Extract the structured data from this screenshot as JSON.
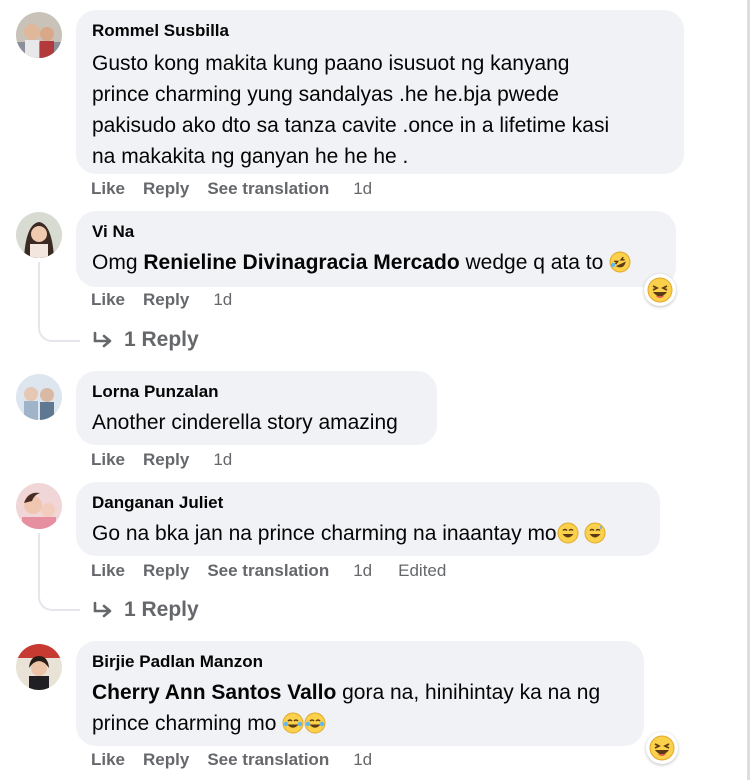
{
  "comments": [
    {
      "author": "Rommel Susbilla",
      "lines": [
        "Gusto kong makita kung paano isusuot ng kanyang",
        "prince charming yung sandalyas .he he.bja pwede",
        "pakisudo ako dto sa tanza cavite .once in a lifetime kasi",
        "na makakita ng ganyan he he he ."
      ],
      "actions": {
        "like": "Like",
        "reply": "Reply",
        "translate": "See translation",
        "time": "1d"
      }
    },
    {
      "author": "Vi Na",
      "prefix": "Omg",
      "mention": "Renieline Divinagracia Mercado",
      "suffix": "wedge q ata to",
      "actions": {
        "like": "Like",
        "reply": "Reply",
        "time": "1d"
      },
      "replies_label": "1 Reply",
      "reaction_icon": "laughing-emoji"
    },
    {
      "author": "Lorna Punzalan",
      "text": "Another cinderella story amazing",
      "actions": {
        "like": "Like",
        "reply": "Reply",
        "time": "1d"
      }
    },
    {
      "author": "Danganan Juliet",
      "text": "Go na bka jan na prince charming na inaantay mo",
      "actions": {
        "like": "Like",
        "reply": "Reply",
        "translate": "See translation",
        "time": "1d",
        "edited": "Edited"
      },
      "replies_label": "1 Reply"
    },
    {
      "author": "Birjie Padlan Manzon",
      "mention": "Cherry Ann Santos Vallo",
      "suffix": "gora na, hinihintay ka na ng",
      "line2": "prince charming mo",
      "actions": {
        "like": "Like",
        "reply": "Reply",
        "translate": "See translation",
        "time": "1d"
      },
      "reaction_icon": "laughing-emoji"
    }
  ],
  "colors": {
    "bubble": "#f0f2f5",
    "secondary_text": "#65676b",
    "primary_text": "#050505",
    "thread_line": "#e4e6eb"
  }
}
